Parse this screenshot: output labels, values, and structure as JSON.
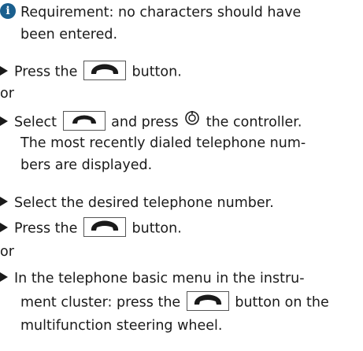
{
  "lines": {
    "l1": "Requirement: no characters should have",
    "l2": "been entered.",
    "l3a": "Press the",
    "l3b": "button.",
    "or1": "or",
    "l4a": "Select",
    "l4b": "and press",
    "l4c": "the controller.",
    "l5": "The most recently dialed telephone num-",
    "l6": "bers are displayed.",
    "l7": "Select the desired telephone number.",
    "l8a": "Press the",
    "l8b": "button.",
    "or2": "or",
    "l9": "In the telephone basic menu in the instru-",
    "l10a": "ment cluster: press the",
    "l10b": "button on the",
    "l11": "multifunction steering wheel."
  },
  "icons": {
    "info": "i",
    "phone_button": "phone-button-icon",
    "phone_handset": "phone-handset-icon",
    "controller": "controller-press-icon",
    "bullet": "triangle-bullet-icon"
  }
}
